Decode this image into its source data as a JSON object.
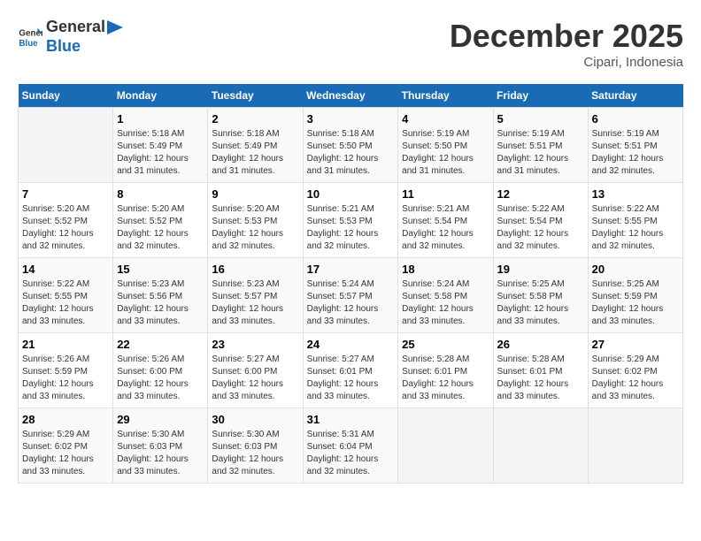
{
  "header": {
    "logo_line1": "General",
    "logo_line2": "Blue",
    "month_title": "December 2025",
    "location": "Cipari, Indonesia"
  },
  "days_of_week": [
    "Sunday",
    "Monday",
    "Tuesday",
    "Wednesday",
    "Thursday",
    "Friday",
    "Saturday"
  ],
  "weeks": [
    [
      {
        "day": "",
        "sunrise": "",
        "sunset": "",
        "daylight": ""
      },
      {
        "day": "1",
        "sunrise": "Sunrise: 5:18 AM",
        "sunset": "Sunset: 5:49 PM",
        "daylight": "Daylight: 12 hours and 31 minutes."
      },
      {
        "day": "2",
        "sunrise": "Sunrise: 5:18 AM",
        "sunset": "Sunset: 5:49 PM",
        "daylight": "Daylight: 12 hours and 31 minutes."
      },
      {
        "day": "3",
        "sunrise": "Sunrise: 5:18 AM",
        "sunset": "Sunset: 5:50 PM",
        "daylight": "Daylight: 12 hours and 31 minutes."
      },
      {
        "day": "4",
        "sunrise": "Sunrise: 5:19 AM",
        "sunset": "Sunset: 5:50 PM",
        "daylight": "Daylight: 12 hours and 31 minutes."
      },
      {
        "day": "5",
        "sunrise": "Sunrise: 5:19 AM",
        "sunset": "Sunset: 5:51 PM",
        "daylight": "Daylight: 12 hours and 31 minutes."
      },
      {
        "day": "6",
        "sunrise": "Sunrise: 5:19 AM",
        "sunset": "Sunset: 5:51 PM",
        "daylight": "Daylight: 12 hours and 32 minutes."
      }
    ],
    [
      {
        "day": "7",
        "sunrise": "Sunrise: 5:20 AM",
        "sunset": "Sunset: 5:52 PM",
        "daylight": "Daylight: 12 hours and 32 minutes."
      },
      {
        "day": "8",
        "sunrise": "Sunrise: 5:20 AM",
        "sunset": "Sunset: 5:52 PM",
        "daylight": "Daylight: 12 hours and 32 minutes."
      },
      {
        "day": "9",
        "sunrise": "Sunrise: 5:20 AM",
        "sunset": "Sunset: 5:53 PM",
        "daylight": "Daylight: 12 hours and 32 minutes."
      },
      {
        "day": "10",
        "sunrise": "Sunrise: 5:21 AM",
        "sunset": "Sunset: 5:53 PM",
        "daylight": "Daylight: 12 hours and 32 minutes."
      },
      {
        "day": "11",
        "sunrise": "Sunrise: 5:21 AM",
        "sunset": "Sunset: 5:54 PM",
        "daylight": "Daylight: 12 hours and 32 minutes."
      },
      {
        "day": "12",
        "sunrise": "Sunrise: 5:22 AM",
        "sunset": "Sunset: 5:54 PM",
        "daylight": "Daylight: 12 hours and 32 minutes."
      },
      {
        "day": "13",
        "sunrise": "Sunrise: 5:22 AM",
        "sunset": "Sunset: 5:55 PM",
        "daylight": "Daylight: 12 hours and 32 minutes."
      }
    ],
    [
      {
        "day": "14",
        "sunrise": "Sunrise: 5:22 AM",
        "sunset": "Sunset: 5:55 PM",
        "daylight": "Daylight: 12 hours and 33 minutes."
      },
      {
        "day": "15",
        "sunrise": "Sunrise: 5:23 AM",
        "sunset": "Sunset: 5:56 PM",
        "daylight": "Daylight: 12 hours and 33 minutes."
      },
      {
        "day": "16",
        "sunrise": "Sunrise: 5:23 AM",
        "sunset": "Sunset: 5:57 PM",
        "daylight": "Daylight: 12 hours and 33 minutes."
      },
      {
        "day": "17",
        "sunrise": "Sunrise: 5:24 AM",
        "sunset": "Sunset: 5:57 PM",
        "daylight": "Daylight: 12 hours and 33 minutes."
      },
      {
        "day": "18",
        "sunrise": "Sunrise: 5:24 AM",
        "sunset": "Sunset: 5:58 PM",
        "daylight": "Daylight: 12 hours and 33 minutes."
      },
      {
        "day": "19",
        "sunrise": "Sunrise: 5:25 AM",
        "sunset": "Sunset: 5:58 PM",
        "daylight": "Daylight: 12 hours and 33 minutes."
      },
      {
        "day": "20",
        "sunrise": "Sunrise: 5:25 AM",
        "sunset": "Sunset: 5:59 PM",
        "daylight": "Daylight: 12 hours and 33 minutes."
      }
    ],
    [
      {
        "day": "21",
        "sunrise": "Sunrise: 5:26 AM",
        "sunset": "Sunset: 5:59 PM",
        "daylight": "Daylight: 12 hours and 33 minutes."
      },
      {
        "day": "22",
        "sunrise": "Sunrise: 5:26 AM",
        "sunset": "Sunset: 6:00 PM",
        "daylight": "Daylight: 12 hours and 33 minutes."
      },
      {
        "day": "23",
        "sunrise": "Sunrise: 5:27 AM",
        "sunset": "Sunset: 6:00 PM",
        "daylight": "Daylight: 12 hours and 33 minutes."
      },
      {
        "day": "24",
        "sunrise": "Sunrise: 5:27 AM",
        "sunset": "Sunset: 6:01 PM",
        "daylight": "Daylight: 12 hours and 33 minutes."
      },
      {
        "day": "25",
        "sunrise": "Sunrise: 5:28 AM",
        "sunset": "Sunset: 6:01 PM",
        "daylight": "Daylight: 12 hours and 33 minutes."
      },
      {
        "day": "26",
        "sunrise": "Sunrise: 5:28 AM",
        "sunset": "Sunset: 6:01 PM",
        "daylight": "Daylight: 12 hours and 33 minutes."
      },
      {
        "day": "27",
        "sunrise": "Sunrise: 5:29 AM",
        "sunset": "Sunset: 6:02 PM",
        "daylight": "Daylight: 12 hours and 33 minutes."
      }
    ],
    [
      {
        "day": "28",
        "sunrise": "Sunrise: 5:29 AM",
        "sunset": "Sunset: 6:02 PM",
        "daylight": "Daylight: 12 hours and 33 minutes."
      },
      {
        "day": "29",
        "sunrise": "Sunrise: 5:30 AM",
        "sunset": "Sunset: 6:03 PM",
        "daylight": "Daylight: 12 hours and 33 minutes."
      },
      {
        "day": "30",
        "sunrise": "Sunrise: 5:30 AM",
        "sunset": "Sunset: 6:03 PM",
        "daylight": "Daylight: 12 hours and 32 minutes."
      },
      {
        "day": "31",
        "sunrise": "Sunrise: 5:31 AM",
        "sunset": "Sunset: 6:04 PM",
        "daylight": "Daylight: 12 hours and 32 minutes."
      },
      {
        "day": "",
        "sunrise": "",
        "sunset": "",
        "daylight": ""
      },
      {
        "day": "",
        "sunrise": "",
        "sunset": "",
        "daylight": ""
      },
      {
        "day": "",
        "sunrise": "",
        "sunset": "",
        "daylight": ""
      }
    ]
  ]
}
